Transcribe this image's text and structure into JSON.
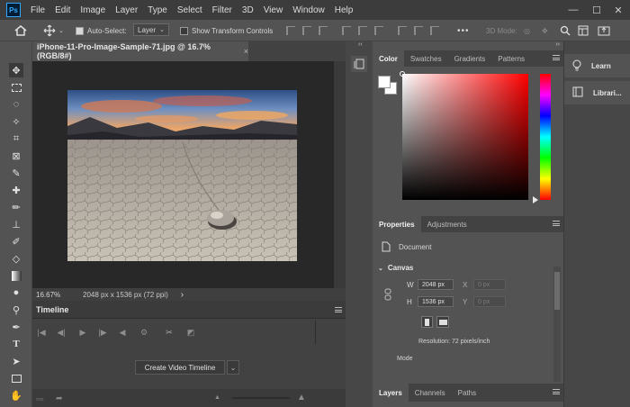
{
  "app": {
    "logo": "Ps"
  },
  "menu": [
    "File",
    "Edit",
    "Image",
    "Layer",
    "Type",
    "Select",
    "Filter",
    "3D",
    "View",
    "Window",
    "Help"
  ],
  "window_controls": {
    "minimize": "—",
    "maximize": "☐",
    "close": "✕"
  },
  "options": {
    "auto_select_label": "Auto-Select:",
    "auto_select_value": "Layer",
    "transform_label": "Show Transform Controls",
    "mode_3d": "3D Mode:",
    "more": "•••"
  },
  "document": {
    "tab_title": "iPhone-11-Pro-Image-Sample-71.jpg @ 16.7% (RGB/8#)",
    "close": "×",
    "zoom": "16.67%",
    "info": "2048 px x 1536 px (72 ppi)",
    "info_arrow": "›"
  },
  "timeline": {
    "title": "Timeline",
    "create_button": "Create Video Timeline",
    "dropdown": "⌄"
  },
  "color_panel": {
    "tabs": [
      "Color",
      "Swatches",
      "Gradients",
      "Patterns"
    ],
    "foreground": "#ffffff",
    "background": "#ffffff"
  },
  "properties_panel": {
    "tabs": [
      "Properties",
      "Adjustments"
    ],
    "type_label": "Document",
    "section": "Canvas",
    "w_label": "W",
    "w_value": "2048 px",
    "h_label": "H",
    "h_value": "1536 px",
    "x_label": "X",
    "x_value": "0 px",
    "y_label": "Y",
    "y_value": "0 px",
    "resolution": "Resolution: 72 pixels/inch",
    "mode_label": "Mode"
  },
  "layers_panel": {
    "tabs": [
      "Layers",
      "Channels",
      "Paths"
    ]
  },
  "right_dock": {
    "learn": "Learn",
    "libraries": "Librari..."
  },
  "collapse": {
    "left": "‹‹",
    "right": "››"
  }
}
